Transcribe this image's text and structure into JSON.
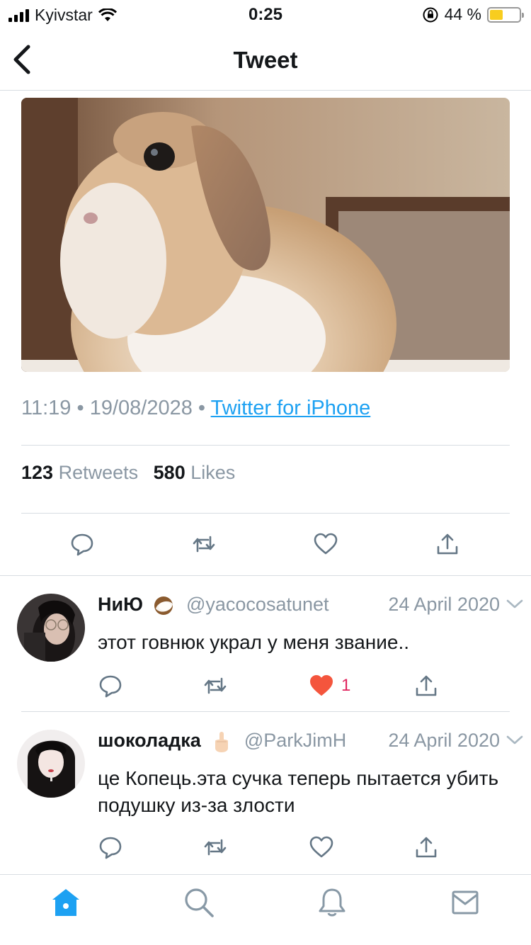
{
  "status_bar": {
    "carrier": "Kyivstar",
    "time": "0:25",
    "battery_percent": "44 %",
    "battery_level": 0.44
  },
  "nav": {
    "title": "Tweet"
  },
  "tweet": {
    "time": "11:19",
    "date": "19/08/2028",
    "source": "Twitter for iPhone",
    "retweets_count": "123",
    "retweets_label": "Retweets",
    "likes_count": "580",
    "likes_label": "Likes"
  },
  "replies": [
    {
      "name": "НиЮ",
      "emoji": "coconut",
      "handle": "@yacocosatunet",
      "date": "24 April 2020",
      "text": "этот говнюк украл у меня звание..",
      "likes": "1",
      "liked": true
    },
    {
      "name": "шоколадка",
      "emoji": "middle-finger",
      "handle": "@ParkJimH",
      "date": "24 April 2020",
      "text": "це Копець.эта сучка теперь пытается убить подушку из-за злости",
      "likes": "",
      "liked": false
    }
  ],
  "tabs": [
    "home-icon",
    "search-icon",
    "notifications-icon",
    "messages-icon"
  ],
  "colors": {
    "accent": "#1da1f2",
    "muted": "#8a97a3",
    "like": "#e0245e",
    "icon": "#657786"
  }
}
